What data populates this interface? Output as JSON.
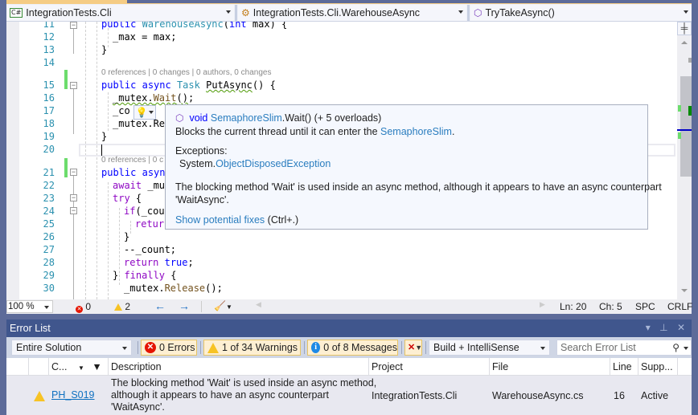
{
  "navbar": {
    "project": "IntegrationTests.Cli",
    "project_icon": "C#",
    "type": "IntegrationTests.Cli.WarehouseAsync",
    "member": "TryTakeAsync()"
  },
  "editor": {
    "lines": [
      {
        "n": "11",
        "code": "public WarehouseAsync(int max) {"
      },
      {
        "n": "12",
        "code": "_max = max;"
      },
      {
        "n": "13",
        "code": "}"
      },
      {
        "n": "14",
        "code": ""
      },
      {
        "n": "15",
        "code": "public async Task PutAsync() {"
      },
      {
        "n": "16",
        "code": "_mutex.Wait();"
      },
      {
        "n": "17",
        "code": "_co      ;"
      },
      {
        "n": "18",
        "code": "_mutex.Re"
      },
      {
        "n": "19",
        "code": "}"
      },
      {
        "n": "20",
        "code": ""
      },
      {
        "n": "21",
        "code": "public asyn"
      },
      {
        "n": "22",
        "code": "await _mut"
      },
      {
        "n": "23",
        "code": "try {"
      },
      {
        "n": "24",
        "code": "if(_cou"
      },
      {
        "n": "25",
        "code": "retur"
      },
      {
        "n": "26",
        "code": "}"
      },
      {
        "n": "27",
        "code": "--_count;"
      },
      {
        "n": "28",
        "code": "return true;"
      },
      {
        "n": "29",
        "code": "} finally {"
      },
      {
        "n": "30",
        "code": "_mutex.Release();"
      }
    ],
    "codelens_1": "0 references | 0 changes | 0 authors, 0 changes",
    "codelens_2": "0 references | 0 c"
  },
  "tooltip": {
    "signature_kw": "void",
    "signature_type": "SemaphoreSlim",
    "signature_rest": ".Wait() (+ 5 overloads)",
    "summary_pre": "Blocks the current thread until it can enter the ",
    "summary_link": "SemaphoreSlim",
    "summary_post": ".",
    "exceptions_label": "Exceptions:",
    "exception_ns": "System.",
    "exception_type": "ObjectDisposedException",
    "message_line1": "The blocking method 'Wait' is used inside an async method, although it appears to have an async counterpart",
    "message_line2": "'WaitAsync'.",
    "fix_link": "Show potential fixes",
    "fix_shortcut": " (Ctrl+.)"
  },
  "status": {
    "zoom": "100 %",
    "errors": "0",
    "warnings": "2",
    "line": "Ln: 20",
    "char": "Ch: 5",
    "spacing": "SPC",
    "eol": "CRLF"
  },
  "error_list": {
    "title": "Error List",
    "window_controls": "▾ ⊥ ✕",
    "scope": "Entire Solution",
    "errors_btn": "0 Errors",
    "warnings_btn": "1 of 34 Warnings",
    "messages_btn": "0 of 8 Messages",
    "source": "Build + IntelliSense",
    "search_placeholder": "Search Error List",
    "columns": [
      "C...",
      "Description",
      "Project",
      "File",
      "Line",
      "Supp..."
    ],
    "rows": [
      {
        "code": "PH_S019",
        "description_1": "The blocking method 'Wait' is used inside an async method,",
        "description_2": "although it appears to have an async counterpart",
        "description_3": "'WaitAsync'.",
        "project": "IntegrationTests.Cli",
        "file": "WarehouseAsync.cs",
        "line": "16",
        "suppression": "Active"
      }
    ]
  }
}
